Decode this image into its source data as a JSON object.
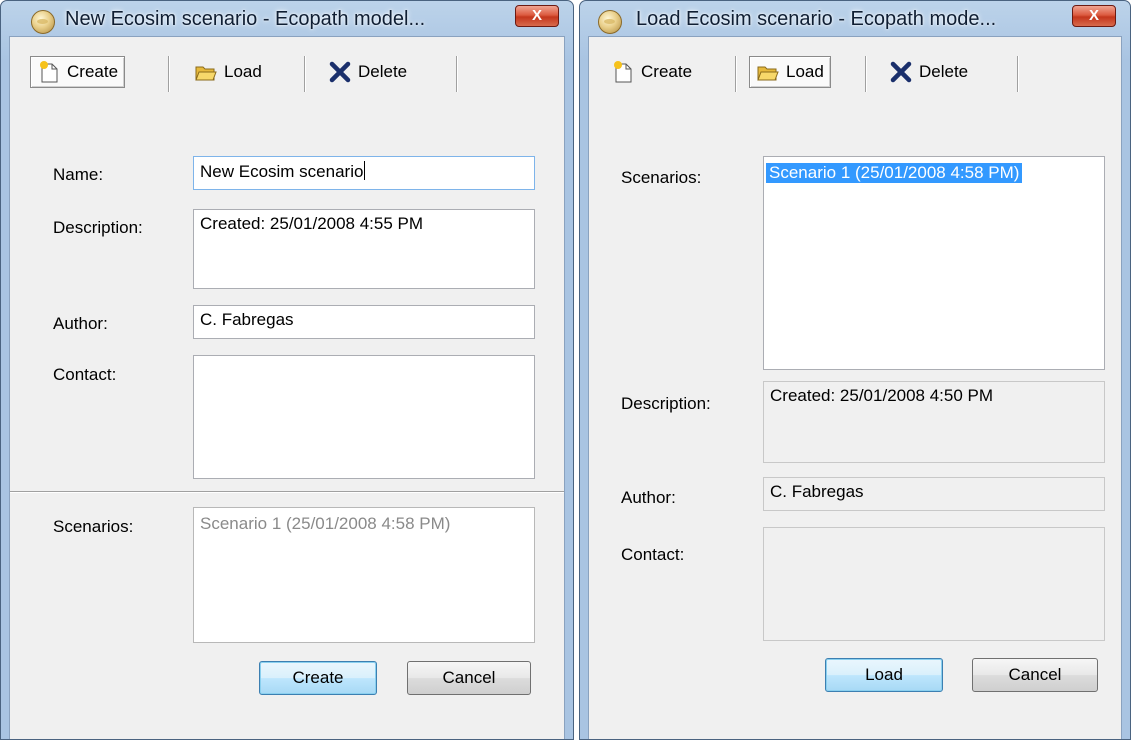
{
  "left": {
    "title": "New Ecosim scenario - Ecopath model...",
    "close_label": "X",
    "toolbar": {
      "create": "Create",
      "load": "Load",
      "delete": "Delete"
    },
    "labels": {
      "name": "Name:",
      "description": "Description:",
      "author": "Author:",
      "contact": "Contact:",
      "scenarios": "Scenarios:"
    },
    "values": {
      "name": "New Ecosim scenario",
      "description": "Created: 25/01/2008 4:55 PM",
      "author": "C. Fabregas",
      "contact": ""
    },
    "scenarios": [
      "Scenario 1 (25/01/2008 4:58 PM)"
    ],
    "buttons": {
      "ok": "Create",
      "cancel": "Cancel"
    }
  },
  "right": {
    "title": "Load Ecosim scenario - Ecopath mode...",
    "close_label": "X",
    "toolbar": {
      "create": "Create",
      "load": "Load",
      "delete": "Delete"
    },
    "labels": {
      "scenarios": "Scenarios:",
      "description": "Description:",
      "author": "Author:",
      "contact": "Contact:"
    },
    "scenarios": [
      "Scenario 1 (25/01/2008 4:58 PM)"
    ],
    "values": {
      "description": "Created: 25/01/2008 4:50 PM",
      "author": "C. Fabregas",
      "contact": ""
    },
    "buttons": {
      "ok": "Load",
      "cancel": "Cancel"
    }
  },
  "colors": {
    "selection": "#3399ff",
    "close_button": "#c4361c",
    "window_frame": "#a9c4e2"
  },
  "icons": {
    "app": "ecopath-globe-icon",
    "create": "new-document-icon",
    "load": "open-folder-icon",
    "delete": "delete-x-icon",
    "close": "close-icon"
  }
}
